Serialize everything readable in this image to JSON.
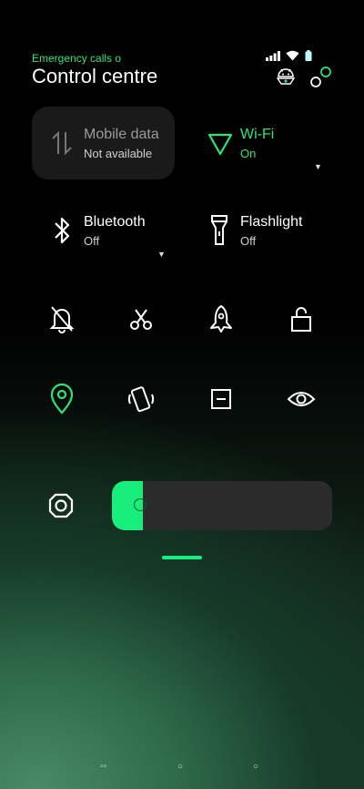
{
  "status": {
    "emergency_text": "Emergency calls o"
  },
  "header": {
    "title": "Control centre"
  },
  "tiles": {
    "mobile": {
      "label": "Mobile data",
      "sub": "Not available"
    },
    "wifi": {
      "label": "Wi-Fi",
      "sub": "On"
    },
    "bluetooth": {
      "label": "Bluetooth",
      "sub": "Off"
    },
    "flashlight": {
      "label": "Flashlight",
      "sub": "Off"
    }
  },
  "quick_icons": [
    "silent-bell-icon",
    "scissors-icon",
    "airplane-icon",
    "unlock-icon",
    "location-icon",
    "auto-rotate-icon",
    "mode-icon",
    "eye-icon"
  ],
  "brightness": {
    "level": 0.14,
    "icon": "brightness-octagon-icon"
  },
  "colors": {
    "accent": "#2ee37a",
    "fill": "#18ee7b",
    "tile_bg": "#1a1a1a"
  },
  "nav": {
    "recents": "▫▫",
    "home": "○",
    "back": "○"
  }
}
